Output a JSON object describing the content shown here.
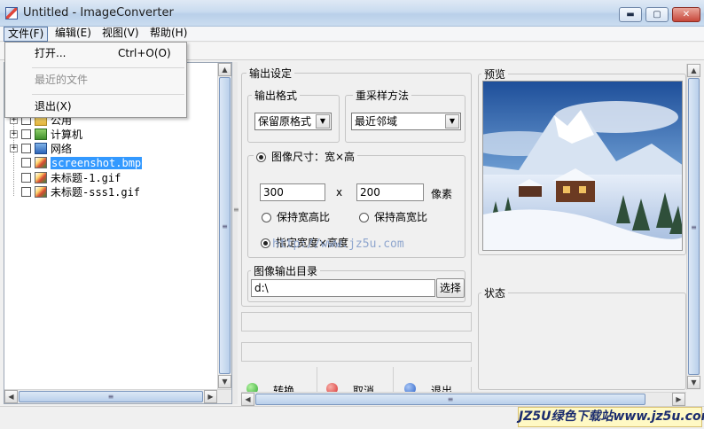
{
  "window": {
    "title": "Untitled - ImageConverter",
    "min": "▬",
    "max": "▢",
    "close": "✕"
  },
  "menubar": [
    "文件(F)",
    "编辑(E)",
    "视图(V)",
    "帮助(H)"
  ],
  "file_menu": {
    "open": "打开...",
    "open_shortcut": "Ctrl+O(O)",
    "recent": "最近的文件",
    "exit": "退出(X)"
  },
  "tree": {
    "items": [
      {
        "label": "公用",
        "icon": "folder-icon",
        "expandable": true
      },
      {
        "label": "计算机",
        "icon": "computer-icon",
        "expandable": true
      },
      {
        "label": "网络",
        "icon": "network-icon",
        "expandable": true
      },
      {
        "label": "screenshot.bmp",
        "icon": "image-icon",
        "expandable": false,
        "selected": true
      },
      {
        "label": "未标题-1.gif",
        "icon": "image-icon",
        "expandable": false
      },
      {
        "label": "未标题-sss1.gif",
        "icon": "image-icon",
        "expandable": false
      }
    ]
  },
  "output": {
    "group_title": "输出设定",
    "format_label": "输出格式",
    "format_value": "保留原格式",
    "resample_label": "重采样方法",
    "resample_value": "最近邻域",
    "size_option": "图像尺寸：宽×高",
    "width": "300",
    "times": "x",
    "height": "200",
    "unit": "像素",
    "keep_wh": "保持宽高比",
    "keep_hw": "保持高宽比",
    "specify_wh": "指定宽度×高度",
    "dir_label": "图像输出目录",
    "dir_value": "d:\\",
    "browse": "选择"
  },
  "actions": {
    "convert": "转换",
    "cancel": "取消",
    "exit": "退出"
  },
  "preview": {
    "label": "预览"
  },
  "status": {
    "label": "状态"
  },
  "watermark": {
    "url": "http://www.jz5u.com",
    "banner": "JZ5U绿色下载站www.jz5u.com"
  },
  "colors": {
    "selection": "#3399ff",
    "convert_ball": "#2faa2f",
    "cancel_ball": "#d83030",
    "exit_ball": "#2a62c9"
  }
}
